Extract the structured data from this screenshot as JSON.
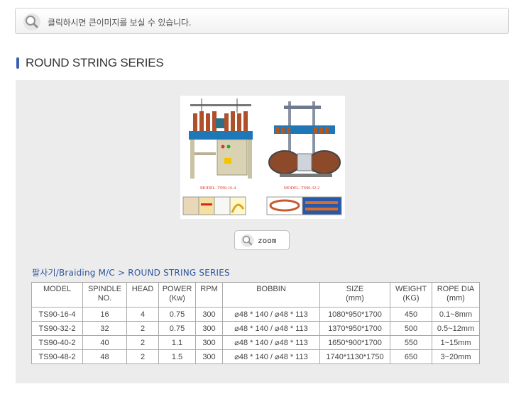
{
  "notice": {
    "text": "클릭하시면 큰이미지를 보실 수 있습니다."
  },
  "section": {
    "title": "ROUND STRING SERIES"
  },
  "photo": {
    "captions": [
      "MODEL. TS90-16-4",
      "MODEL. TS90-32-2"
    ]
  },
  "zoom": {
    "label": "zoom"
  },
  "breadcrumb": {
    "parent": "팔사기/Braiding M/C",
    "separator": ">",
    "current": "ROUND STRING SERIES"
  },
  "table": {
    "headers": [
      [
        "MODEL"
      ],
      [
        "SPINDLE",
        "NO."
      ],
      [
        "HEAD"
      ],
      [
        "POWER",
        "(Kw)"
      ],
      [
        "RPM"
      ],
      [
        "BOBBIN"
      ],
      [
        "SIZE",
        "(mm)"
      ],
      [
        "WEIGHT",
        "(KG)"
      ],
      [
        "ROPE DIA",
        "(mm)"
      ]
    ],
    "rows": [
      [
        "TS90-16-4",
        "16",
        "4",
        "0.75",
        "300",
        "⌀48 * 140 / ⌀48 * 113",
        "1080*950*1700",
        "450",
        "0.1~8mm"
      ],
      [
        "TS90-32-2",
        "32",
        "2",
        "0.75",
        "300",
        "⌀48 * 140 / ⌀48 * 113",
        "1370*950*1700",
        "500",
        "0.5~12mm"
      ],
      [
        "TS90-40-2",
        "40",
        "2",
        "1.1",
        "300",
        "⌀48 * 140 / ⌀48 * 113",
        "1650*900*1700",
        "550",
        "1~15mm"
      ],
      [
        "TS90-48-2",
        "48",
        "2",
        "1.5",
        "300",
        "⌀48 * 140 / ⌀48 * 113",
        "1740*1130*1750",
        "650",
        "3~20mm"
      ]
    ]
  },
  "colors": {
    "accent": "#3b5fb0",
    "link": "#2d55a0",
    "panel": "#ececec"
  }
}
